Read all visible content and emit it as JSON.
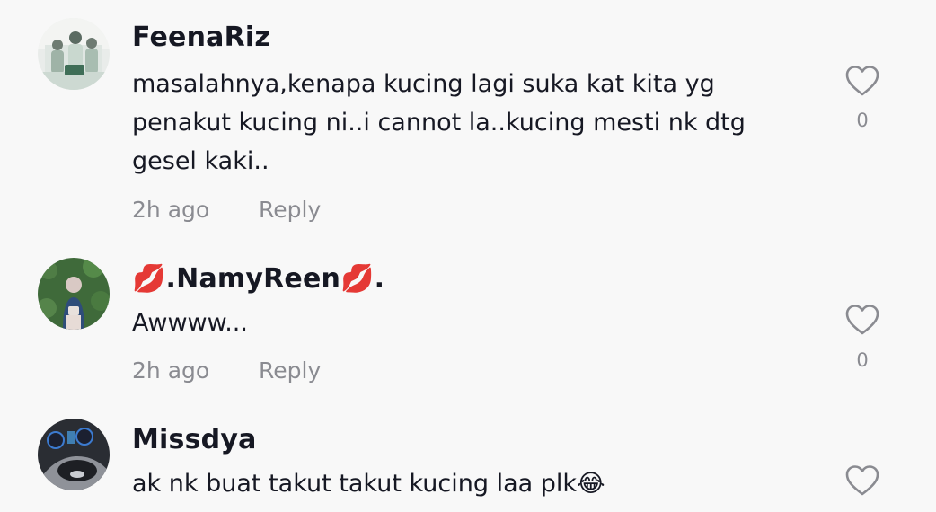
{
  "comments": [
    {
      "username": "FeenaRiz",
      "text": "masalahnya,kenapa kucing lagi suka kat kita yg penakut kucing ni..i cannot la..kucing mesti nk dtg gesel kaki..",
      "time": "2h ago",
      "reply_label": "Reply",
      "likes": "0"
    },
    {
      "username": "💋.NamyReen💋.",
      "text": "Awwww...",
      "time": "2h ago",
      "reply_label": "Reply",
      "likes": "0"
    },
    {
      "username": "Missdya",
      "text": "ak nk buat takut takut kucing laa plk😂"
    }
  ],
  "icons": {
    "like": "heart-outline-icon"
  },
  "colors": {
    "background": "#f8f8f8",
    "primary_text": "#161823",
    "secondary_text": "#8a8b91",
    "icon_stroke": "#8a8b91"
  }
}
